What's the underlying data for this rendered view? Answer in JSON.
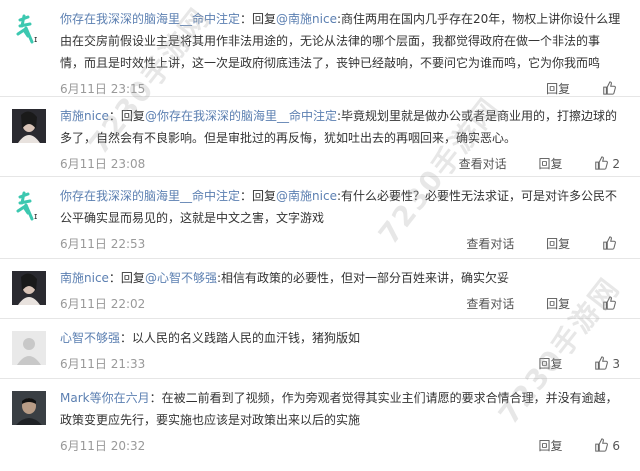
{
  "comments": [
    {
      "user": "你存在我深深的脑海里__命中注定",
      "text_prefix": "：回复",
      "mention": "@南施nice",
      "text": ":商住两用在国内几乎存在20年，物权上讲你设什么理由在交房前假设业主是将其用作非法用途的，无论从法律的哪个层面，我都觉得政府在做一个非法的事情，而且是时效性上讲，这一次是政府彻底违法了，丧钟已经敲响，不要问它为谁而鸣，它为你我而鸣",
      "time": "6月11日 23:15",
      "reply_label": "回复",
      "like_count": ""
    },
    {
      "user": "南施nice",
      "text_prefix": "：回复",
      "mention": "@你存在我深深的脑海里__命中注定",
      "text": ":毕竟规划里就是做办公或者是商业用的，打擦边球的多了，自然会有不良影响。但是审批过的再反悔，犹如吐出去的再咽回来，确实恶心。",
      "time": "6月11日 23:08",
      "view_conversation_label": "查看对话",
      "reply_label": "回复",
      "like_count": "2"
    },
    {
      "user": "你存在我深深的脑海里__命中注定",
      "text_prefix": "：回复",
      "mention": "@南施nice",
      "text": ":有什么必要性？必要性无法求证，可是对许多公民不公平确实显而易见的，这就是中文之害，文字游戏",
      "time": "6月11日 22:53",
      "view_conversation_label": "查看对话",
      "reply_label": "回复",
      "like_count": ""
    },
    {
      "user": "南施nice",
      "text_prefix": "：回复",
      "mention": "@心智不够强",
      "text": ":相信有政策的必要性，但对一部分百姓来讲，确实欠妥",
      "time": "6月11日 22:02",
      "view_conversation_label": "查看对话",
      "reply_label": "回复",
      "like_count": ""
    },
    {
      "user": "心智不够强",
      "text_prefix": "",
      "mention": "",
      "text": "：以人民的名义践踏人民的血汗钱，猪狗版如",
      "time": "6月11日 21:33",
      "reply_label": "回复",
      "like_count": "3"
    },
    {
      "user": "Mark等你在六月",
      "text_prefix": "",
      "mention": "",
      "text": "：在被二前看到了视频，作为旁观者觉得其实业主们请愿的要求合情合理，并没有逾越，政策变更应先行，要实施也应该是对政策出来以后的实施",
      "time": "6月11日 20:32",
      "reply_label": "回复",
      "like_count": "6"
    }
  ],
  "watermark": "7230手游网",
  "colors": {
    "username": "#5b7fb1",
    "time": "#999999",
    "divider": "#e6e6e6"
  },
  "icons": {
    "like": "thumbs-up-icon"
  }
}
